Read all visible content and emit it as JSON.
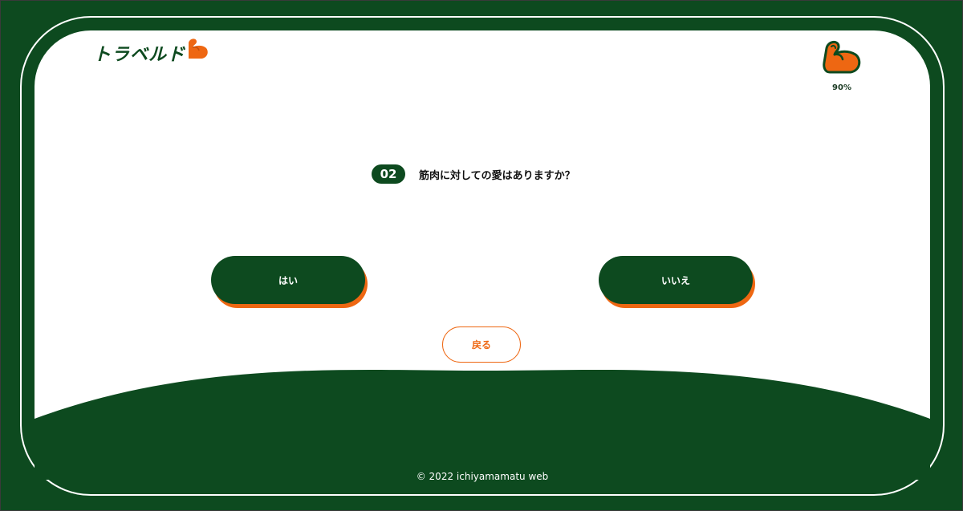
{
  "brand": {
    "logo_text": "トラベルド",
    "accent": "#ee6712",
    "primary": "#0d4a1f"
  },
  "meter": {
    "icon": "flexed-bicep-icon",
    "label": "90%",
    "value": 0.9
  },
  "question": {
    "number": "02",
    "text": "筋肉に対しての愛はありますか？"
  },
  "answers": {
    "yes_label": "はい",
    "no_label": "いいえ"
  },
  "back_label": "戻る",
  "footer": {
    "copyright": "© 2022 ichiyamamatu web"
  }
}
